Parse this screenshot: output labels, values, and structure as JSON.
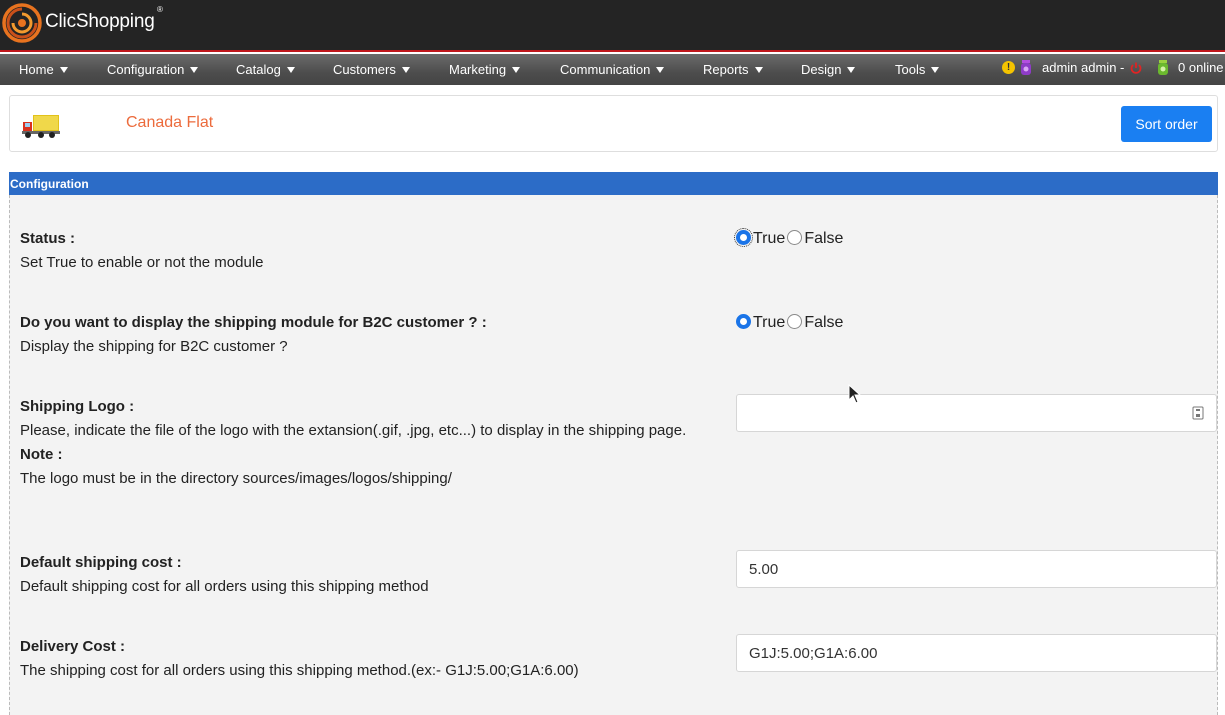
{
  "app": {
    "name": "ClicShopping",
    "reg": "®"
  },
  "nav": {
    "items": [
      {
        "label": "Home"
      },
      {
        "label": "Configuration"
      },
      {
        "label": "Catalog"
      },
      {
        "label": "Customers"
      },
      {
        "label": "Marketing"
      },
      {
        "label": "Communication"
      },
      {
        "label": "Reports"
      },
      {
        "label": "Design"
      },
      {
        "label": "Tools"
      }
    ],
    "user": "admin admin  -",
    "online": "0 online"
  },
  "module": {
    "title": "Canada Flat",
    "sort_button": "Sort order"
  },
  "config": {
    "header": "Configuration",
    "status": {
      "label": "Status :",
      "desc": "Set True to enable or not the module",
      "option_true": "True",
      "option_false": "False",
      "selected": "True"
    },
    "b2c": {
      "label": "Do you want to display the shipping module for B2C customer ? :",
      "desc": "Display the shipping for B2C customer ?",
      "option_true": "True",
      "option_false": "False",
      "selected": "True"
    },
    "logo": {
      "label": "Shipping Logo :",
      "desc": "Please, indicate the file of the logo with the extansion(.gif, .jpg, etc...) to display in the shipping page.",
      "note_label": "Note :",
      "note": "The logo must be in the directory sources/images/logos/shipping/",
      "value": ""
    },
    "default_cost": {
      "label": "Default shipping cost :",
      "desc": "Default shipping cost for all orders using this shipping method",
      "value": "5.00"
    },
    "delivery_cost": {
      "label": "Delivery Cost :",
      "desc": "The shipping cost for all orders using this shipping method.(ex:- G1J:5.00;G1A:6.00)",
      "value": "G1J:5.00;G1A:6.00"
    }
  },
  "colors": {
    "topbar": "#242424",
    "accent_red": "#c0171c",
    "config_header": "#2c6cc7",
    "button": "#1a7ff2",
    "module_title": "#ec6b3c"
  }
}
